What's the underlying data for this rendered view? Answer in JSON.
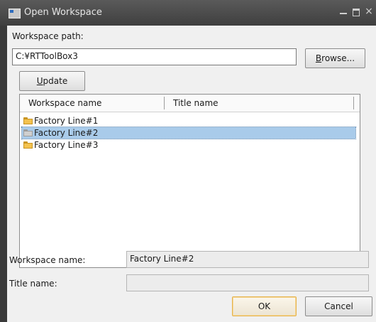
{
  "window": {
    "title": "Open Workspace",
    "close_glyph": "×"
  },
  "form": {
    "path_label": "Workspace path:",
    "path_value": "C:¥RTToolBox3",
    "browse_mnemonic": "B",
    "browse_rest": "rowse...",
    "update_mnemonic": "U",
    "update_rest": "pdate",
    "workspace_name_label": "Workspace name:",
    "workspace_name_value": "Factory Line#2",
    "title_name_label": "Title name:",
    "title_name_value": ""
  },
  "list": {
    "columns": [
      "Workspace name",
      "Title name"
    ],
    "rows": [
      {
        "name": "Factory Line#1",
        "title": "",
        "selected": false
      },
      {
        "name": "Factory Line#2",
        "title": "",
        "selected": true
      },
      {
        "name": "Factory Line#3",
        "title": "",
        "selected": false
      }
    ]
  },
  "buttons": {
    "ok": "OK",
    "cancel": "Cancel"
  },
  "icons": {
    "app": "window-app-icon",
    "folder": "folder-icon",
    "minimize": "minimize-icon",
    "maximize": "maximize-icon",
    "close": "close-icon"
  },
  "colors": {
    "titlebar": "#3f3f3f",
    "selection": "#a9cbea",
    "default_button_border": "#e6b34a"
  }
}
